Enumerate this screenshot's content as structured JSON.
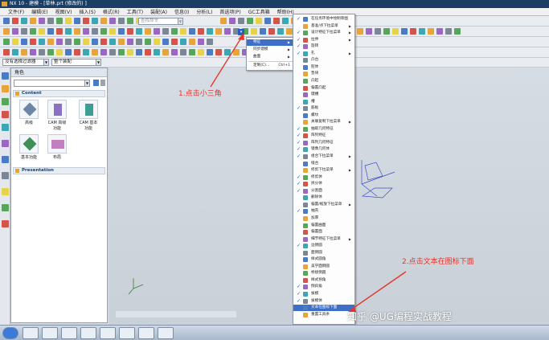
{
  "window": {
    "title": "NX 10 - 建模 - [草林.prt (修改的) ]"
  },
  "menubar": {
    "items": [
      "文件(F)",
      "编辑(E)",
      "视图(V)",
      "插入(S)",
      "格式(R)",
      "工具(T)",
      "装配(A)",
      "信息(I)",
      "分析(L)",
      "首选项(P)",
      "GC工具箱",
      "帮助(H)"
    ]
  },
  "toolbar": {
    "search_placeholder": "查找命令",
    "filter_combo": "没有选择过滤器",
    "assembly_combo": "整个装配",
    "add_remove_button": "添加或移除按钮"
  },
  "submenu1": {
    "items": [
      {
        "label": "特征",
        "highlighted": true,
        "has_submenu": true
      },
      {
        "label": "同步建模",
        "has_submenu": true
      },
      {
        "label": "曲面",
        "has_submenu": true
      },
      {
        "label": "定制(C)...",
        "shortcut": "Ctrl+1"
      }
    ]
  },
  "submenu2": {
    "items": [
      {
        "label": "在任务环境中绘制草图",
        "checked": true
      },
      {
        "label": "基准/点下拉菜单",
        "checked": false,
        "sub": true
      },
      {
        "label": "设计特征下拉菜单",
        "checked": true,
        "sub": true
      },
      {
        "label": "拉伸",
        "checked": true,
        "sub": true
      },
      {
        "label": "旋转",
        "checked": true
      },
      {
        "label": "孔",
        "checked": true,
        "sub": true
      },
      {
        "label": "凸台",
        "checked": false
      },
      {
        "label": "腔体",
        "checked": false
      },
      {
        "label": "垫块",
        "checked": false
      },
      {
        "label": "凸起",
        "checked": false
      },
      {
        "label": "偏置凸起",
        "checked": false
      },
      {
        "label": "键槽",
        "checked": false
      },
      {
        "label": "槽",
        "checked": false
      },
      {
        "label": "筋板",
        "checked": true
      },
      {
        "label": "螺纹",
        "checked": false
      },
      {
        "label": "关联复制下拉菜单",
        "checked": false,
        "sub": true
      },
      {
        "label": "抽取几何特征",
        "checked": true
      },
      {
        "label": "阵列特征",
        "checked": true
      },
      {
        "label": "阵列几何特征",
        "checked": true
      },
      {
        "label": "镜像几何体",
        "checked": true
      },
      {
        "label": "组合下拉菜单",
        "checked": true,
        "sub": true
      },
      {
        "label": "缝合",
        "checked": false
      },
      {
        "label": "修剪下拉菜单",
        "checked": false,
        "sub": true
      },
      {
        "label": "修剪体",
        "checked": true
      },
      {
        "label": "拆分体",
        "checked": true
      },
      {
        "label": "分割面",
        "checked": true
      },
      {
        "label": "删除体",
        "checked": false
      },
      {
        "label": "偏置/缩放下拉菜单",
        "checked": false,
        "sub": true
      },
      {
        "label": "抽壳",
        "checked": true
      },
      {
        "label": "加厚",
        "checked": false
      },
      {
        "label": "偏置曲面",
        "checked": false
      },
      {
        "label": "偏置面",
        "checked": false
      },
      {
        "label": "细节特征下拉菜单",
        "checked": false,
        "sub": true
      },
      {
        "label": "边倒圆",
        "checked": true
      },
      {
        "label": "面倒圆",
        "checked": false
      },
      {
        "label": "样式圆角",
        "checked": false
      },
      {
        "label": "美学面倒圆",
        "checked": false
      },
      {
        "label": "桥接倒圆",
        "checked": false
      },
      {
        "label": "样式拐角",
        "checked": false
      },
      {
        "label": "倒斜角",
        "checked": true
      },
      {
        "label": "拔模",
        "checked": true
      },
      {
        "label": "拔模体",
        "checked": true
      },
      {
        "label": "文本在图标下面",
        "checked": false,
        "highlighted": true
      },
      {
        "label": "重置工具条",
        "checked": false
      }
    ]
  },
  "roles_panel": {
    "title": "角色",
    "sections": [
      "Content",
      "Presentation"
    ],
    "roles": [
      "高级",
      "CAM 高级功能",
      "CAM 基本功能",
      "基本功能",
      "布局"
    ]
  },
  "annotations": {
    "step1": "1.点击小三角",
    "step2": "2.点击文本在图标下面"
  },
  "watermark": "知乎 @UG编程实战教程"
}
